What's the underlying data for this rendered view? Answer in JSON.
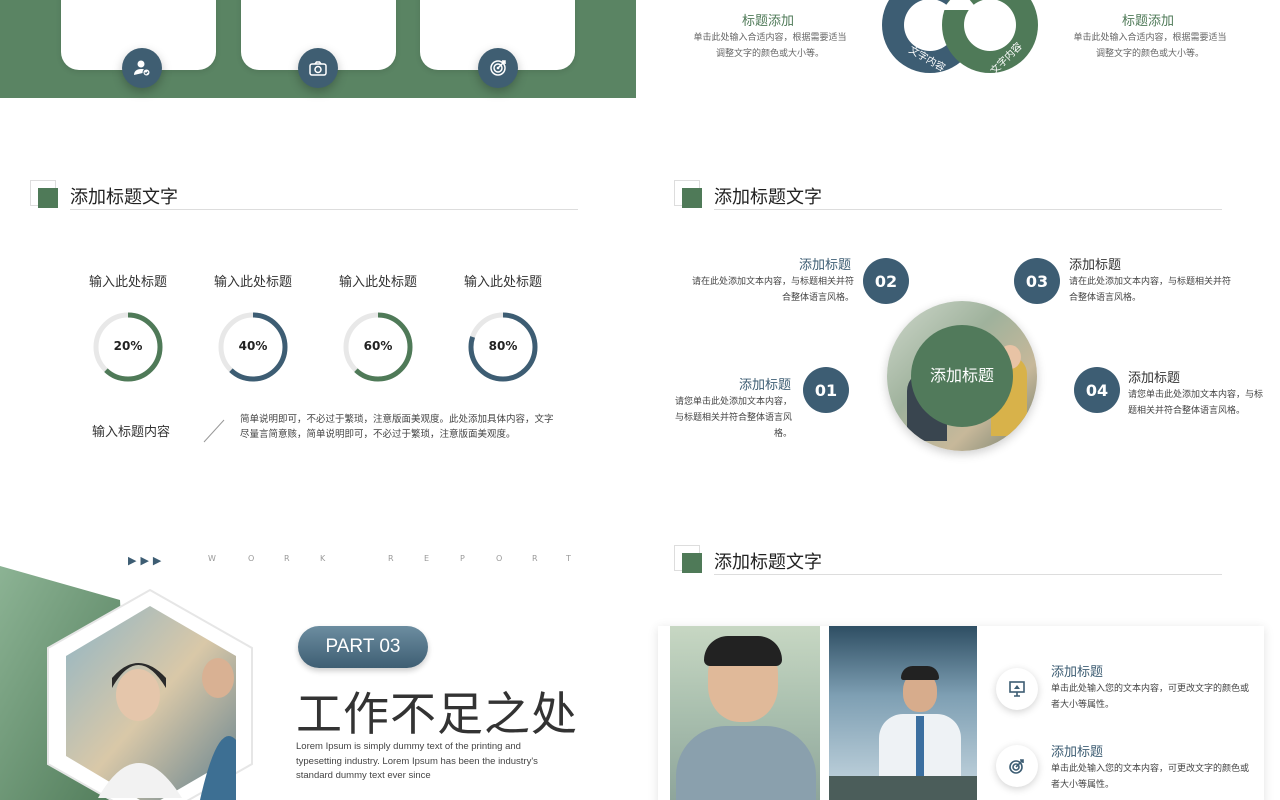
{
  "slide1": {
    "icons": [
      "user-check-icon",
      "camera-icon",
      "target-icon"
    ]
  },
  "slide2": {
    "left": {
      "title": "标题添加",
      "text": "单击此处输入合适内容，根据需要适当调整文字的颜色或大小等。"
    },
    "right": {
      "title": "标题添加",
      "text": "单击此处输入合适内容，根据需要适当调整文字的颜色或大小等。"
    },
    "arrow_left_label": "文字内容",
    "arrow_right_label": "文字内容"
  },
  "slide3": {
    "section_title": "添加标题文字",
    "donuts": [
      {
        "label": "输入此处标题",
        "percent": 20,
        "value_text": "20%",
        "color": "#4f7a58"
      },
      {
        "label": "输入此处标题",
        "percent": 40,
        "value_text": "40%",
        "color": "#3d5d73"
      },
      {
        "label": "输入此处标题",
        "percent": 60,
        "value_text": "60%",
        "color": "#4f7a58"
      },
      {
        "label": "输入此处标题",
        "percent": 80,
        "value_text": "80%",
        "color": "#3d5d73"
      }
    ],
    "content_label": "输入标题内容",
    "content_text": "简单说明即可，不必过于繁琐，注意版面美观度。此处添加具体内容，文字尽量言简意赅，简单说明即可，不必过于繁琐，注意版面美观度。"
  },
  "slide4": {
    "section_title": "添加标题文字",
    "center_text": "添加标题",
    "items": [
      {
        "num": "01",
        "title": "添加标题",
        "text": "请您单击此处添加文本内容，与标题相关并符合整体语言风格。"
      },
      {
        "num": "02",
        "title": "添加标题",
        "text": "请在此处添加文本内容，与标题相关并符合整体语言风格。"
      },
      {
        "num": "03",
        "title": "添加标题",
        "text": "请在此处添加文本内容，与标题相关并符合整体语言风格。"
      },
      {
        "num": "04",
        "title": "添加标题",
        "text": "请您单击此处添加文本内容，与标题相关并符合整体语言风格。"
      }
    ]
  },
  "slide5": {
    "tagline_letters": [
      "W",
      "O",
      "R",
      "K",
      "R",
      "E",
      "P",
      "O",
      "R",
      "T"
    ],
    "part_label": "PART 03",
    "title": "工作不足之处",
    "lorem": "Lorem Ipsum is simply dummy text of the printing and typesetting industry. Lorem Ipsum has been the industry's standard dummy text ever since"
  },
  "slide6": {
    "section_title": "添加标题文字",
    "features": [
      {
        "title": "添加标题",
        "text": "单击此处输入您的文本内容，可更改文字的颜色或者大小等属性。",
        "icon": "presentation-icon"
      },
      {
        "title": "添加标题",
        "text": "单击此处输入您的文本内容，可更改文字的颜色或者大小等属性。",
        "icon": "target-icon"
      }
    ]
  }
}
